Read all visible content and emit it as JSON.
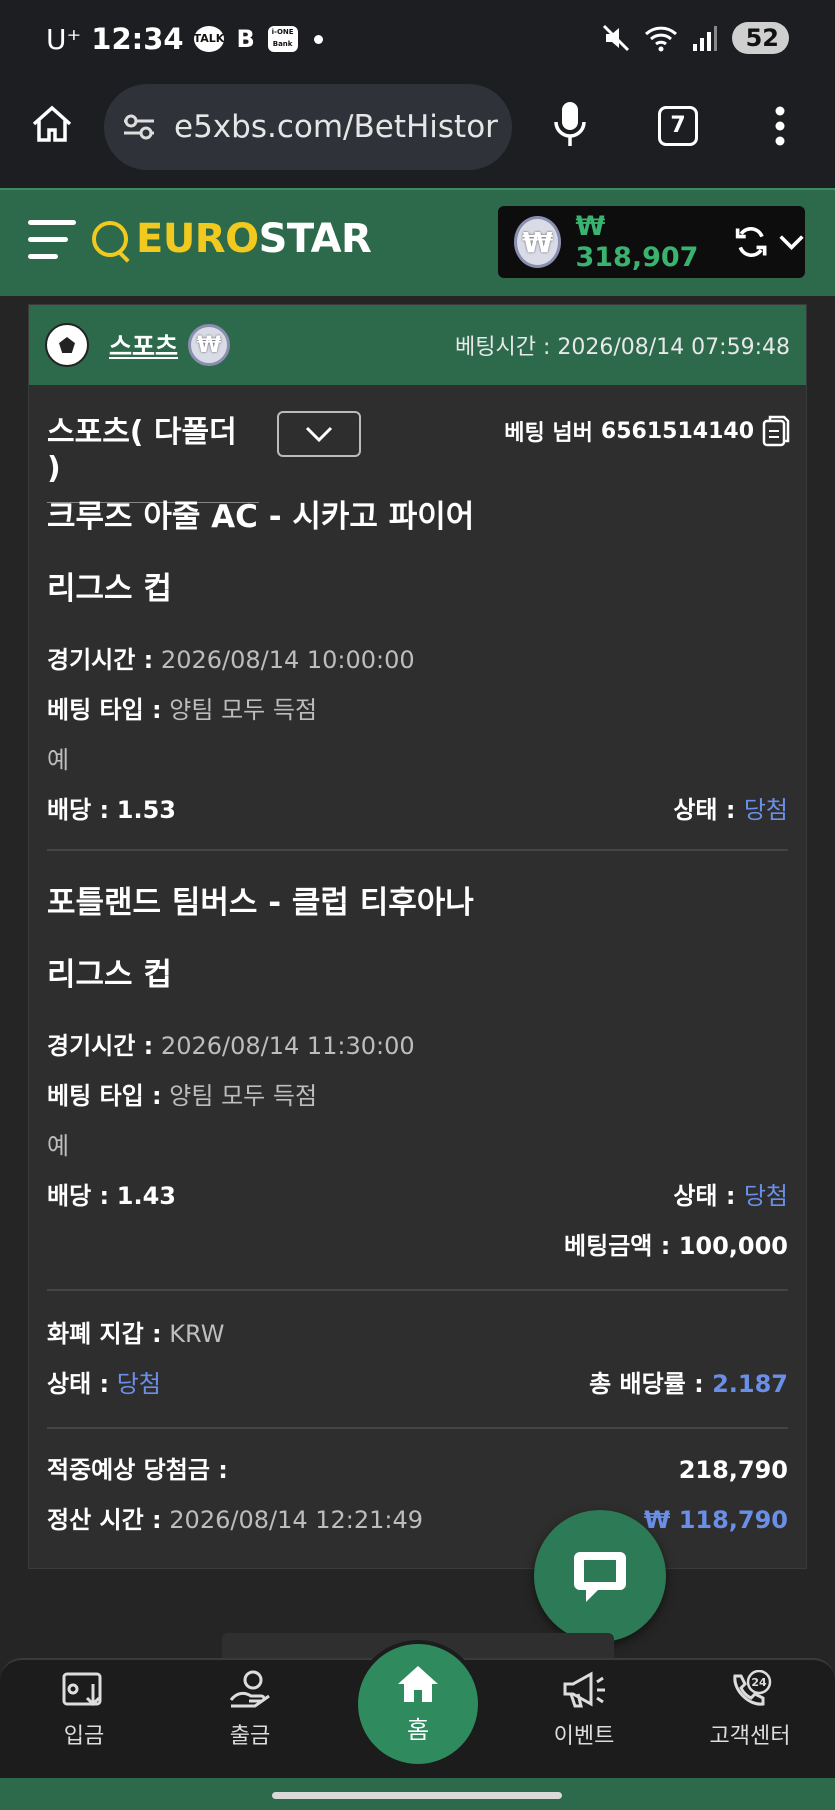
{
  "status_bar": {
    "carrier": "U⁺",
    "time": "12:34",
    "icons": [
      "talk-icon",
      "b-icon",
      "ione-bank-icon"
    ],
    "battery": "52"
  },
  "browser": {
    "url": "e5xbs.com/BetHistor",
    "tab_count": "7"
  },
  "header": {
    "logo_euro": "EURO",
    "logo_star": "STAR",
    "currency_symbol": "₩",
    "balance": "₩ 318,907"
  },
  "card": {
    "category": "스포츠",
    "bet_time_label": "베팅시간 :",
    "bet_time": "2026/08/14 07:59:48",
    "bet_type": "스포츠( 다폴더 )",
    "bet_number_label": "베팅 넘버",
    "bet_number": "6561514140",
    "matches": [
      {
        "title_line1": "크루즈 아줄 AC - 시카고 파이어",
        "title_line2": "리그스 컵",
        "game_time_label": "경기시간 :",
        "game_time": "2026/08/14 10:00:00",
        "bet_type_label": "베팅 타입 :",
        "bet_type": "양팀 모두 득점",
        "pick": "예",
        "odds_label": "배당 :",
        "odds": "1.53",
        "status_label": "상태 :",
        "status": "당첨"
      },
      {
        "title_line1": "포틀랜드 팀버스 - 클럽 티후아나",
        "title_line2": "리그스 컵",
        "game_time_label": "경기시간 :",
        "game_time": "2026/08/14 11:30:00",
        "bet_type_label": "베팅 타입 :",
        "bet_type": "양팀 모두 득점",
        "pick": "예",
        "odds_label": "배당 :",
        "odds": "1.43",
        "status_label": "상태 :",
        "status": "당첨"
      }
    ],
    "bet_amount_label": "베팅금액 :",
    "bet_amount": "100,000",
    "wallet_label": "화폐 지갑 :",
    "wallet_value": "KRW",
    "status_label": "상태 :",
    "status": "당첨",
    "total_odds_label": "총 배당률 :",
    "total_odds": "2.187",
    "expected_win_label": "적중예상 당첨금 :",
    "expected_win": "218,790",
    "settle_time_label": "정산 시간 :",
    "settle_time": "2026/08/14 12:21:49",
    "profit": "₩ 118,790"
  },
  "nav": {
    "deposit": "입금",
    "withdraw": "출금",
    "home": "홈",
    "event": "이벤트",
    "support": "고객센터",
    "support_badge": "24"
  },
  "colors": {
    "brand_green": "#2d6a4b",
    "logo_yellow": "#f2c91e",
    "balance_green": "#39b36f",
    "win_blue": "#6a8fe8"
  }
}
